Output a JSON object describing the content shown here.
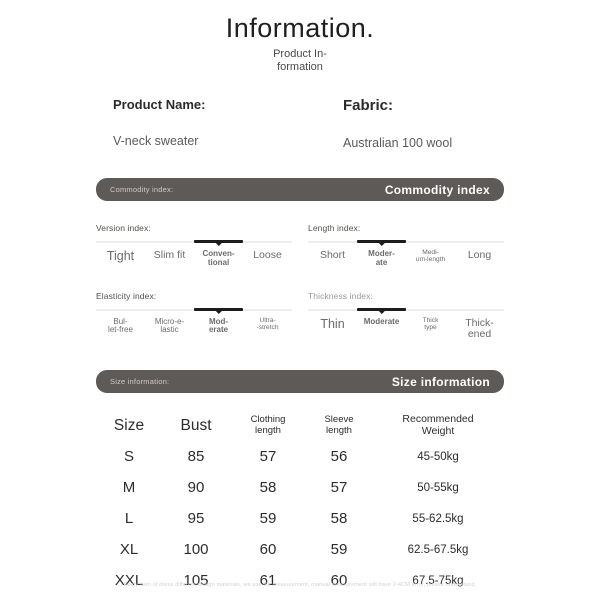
{
  "header": {
    "title": "Information.",
    "subtitle": "Product In-formation"
  },
  "product": {
    "name_label": "Product Name:",
    "name_value": "V-neck sweater",
    "fabric_label": "Fabric:",
    "fabric_value": "Australian 100 wool"
  },
  "commodity_bar": {
    "left_label": "Commodity index:",
    "right_label": "Commodity index"
  },
  "size_bar": {
    "left_label": "Size information:",
    "right_label": "Size information"
  },
  "indexes": [
    {
      "title": "Version index:",
      "active": 2,
      "options": [
        {
          "lines": [
            "Tight"
          ],
          "size": "sz-xl"
        },
        {
          "lines": [
            "Slim fit"
          ],
          "size": "sz-lg"
        },
        {
          "lines": [
            "Conven-",
            "tional"
          ],
          "size": "sz-md"
        },
        {
          "lines": [
            "Loose"
          ],
          "size": "sz-lg"
        }
      ]
    },
    {
      "title": "Length index:",
      "active": 1,
      "options": [
        {
          "lines": [
            "Short"
          ],
          "size": "sz-lg"
        },
        {
          "lines": [
            "Moder-",
            "ate"
          ],
          "size": "sz-md"
        },
        {
          "lines": [
            "Medi-",
            "um-length"
          ],
          "size": "sz-sm"
        },
        {
          "lines": [
            "Long"
          ],
          "size": "sz-lg"
        }
      ]
    },
    {
      "title": "Elasticity index:",
      "active": 2,
      "options": [
        {
          "lines": [
            "Bul-",
            "let-free"
          ],
          "size": "sz-md"
        },
        {
          "lines": [
            "Micro-e-",
            "lastic"
          ],
          "size": "sz-md"
        },
        {
          "lines": [
            "Mod-",
            "erate"
          ],
          "size": "sz-md"
        },
        {
          "lines": [
            "Ultra-",
            "-stretch"
          ],
          "size": "sz-sm"
        }
      ]
    },
    {
      "title": "Thickness index:",
      "active": 1,
      "options": [
        {
          "lines": [
            "Thin"
          ],
          "size": "sz-xl"
        },
        {
          "lines": [
            "Moderate"
          ],
          "size": "sz-md"
        },
        {
          "lines": [
            "Thick",
            "type"
          ],
          "size": "sz-sm"
        },
        {
          "lines": [
            "Thick-",
            "ened"
          ],
          "size": "sz-lg"
        }
      ]
    }
  ],
  "size_table": {
    "headers": [
      "Size",
      "Bust",
      "Clothing length",
      "Sleeve length",
      "Recommended Weight"
    ],
    "header_lines": [
      [
        "Size"
      ],
      [
        "Bust"
      ],
      [
        "Clothing",
        "length"
      ],
      [
        "Sleeve",
        "length"
      ],
      [
        "Recommended",
        "Weight"
      ]
    ],
    "rows": [
      {
        "size": "S",
        "bust": "85",
        "clothing_length": "57",
        "sleeve_length": "56",
        "weight": "45-50kg"
      },
      {
        "size": "M",
        "bust": "90",
        "clothing_length": "58",
        "sleeve_length": "57",
        "weight": "50-55kg"
      },
      {
        "size": "L",
        "bust": "95",
        "clothing_length": "59",
        "sleeve_length": "58",
        "weight": "55-62.5kg"
      },
      {
        "size": "XL",
        "bust": "100",
        "clothing_length": "60",
        "sleeve_length": "59",
        "weight": "62.5-67.5kg"
      },
      {
        "size": "XXL",
        "bust": "105",
        "clothing_length": "61",
        "sleeve_length": "60",
        "weight": "67.5-75kg"
      }
    ]
  },
  "footer": {
    "note": "Every item of dress different design materials, we use tile measurement, manual measurement will have 2-4CM error, please understand."
  },
  "colors": {
    "bar_background": "#5e5a58",
    "slider_active": "#1c1c1c",
    "slider_track": "#ededed",
    "text_primary": "#2c2c2c"
  }
}
